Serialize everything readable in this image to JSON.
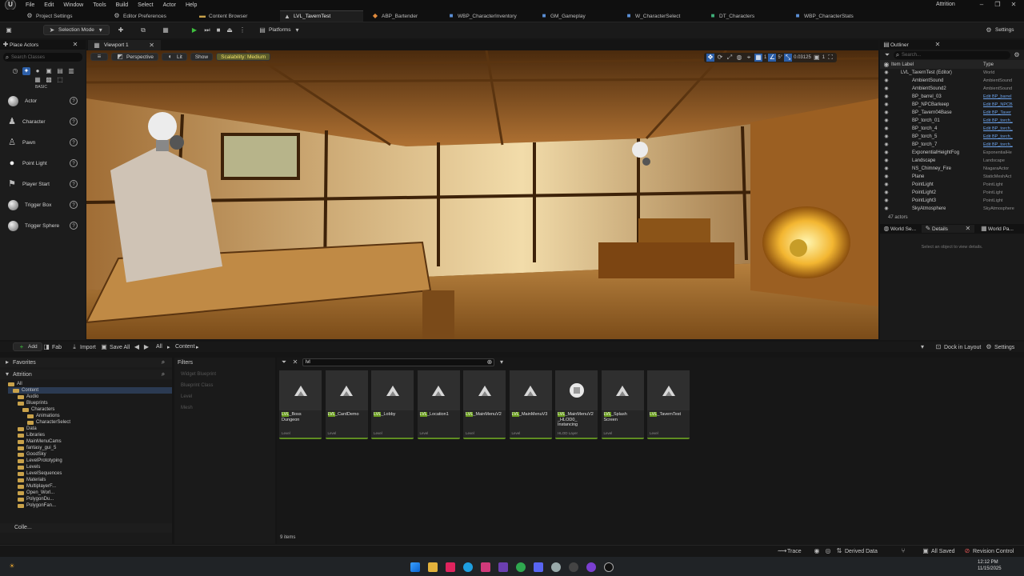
{
  "menu": [
    "File",
    "Edit",
    "Window",
    "Tools",
    "Build",
    "Select",
    "Actor",
    "Help"
  ],
  "project_name": "Attrition",
  "tabs": [
    {
      "label": "Project Settings",
      "icon": "gear-icon"
    },
    {
      "label": "Editor Preferences",
      "icon": "gear-icon"
    },
    {
      "label": "Content Browser",
      "icon": "folder-icon"
    },
    {
      "label": "LVL_TavernTest",
      "icon": "level-icon",
      "active": true
    },
    {
      "label": "ABP_Bartender",
      "icon": "anim-blueprint-icon"
    },
    {
      "label": "WBP_CharacterInventory",
      "icon": "widget-icon"
    },
    {
      "label": "GM_Gameplay",
      "icon": "blueprint-icon"
    },
    {
      "label": "W_CharacterSelect",
      "icon": "widget-icon"
    },
    {
      "label": "DT_Characters",
      "icon": "datatable-icon"
    },
    {
      "label": "WBP_CharacterStats",
      "icon": "widget-icon"
    }
  ],
  "toolbar": {
    "selection_mode": "Selection Mode",
    "platforms": "Platforms",
    "settings": "Settings"
  },
  "place_actors": {
    "title": "Place Actors",
    "search_placeholder": "Search Classes",
    "category": "BASIC",
    "items": [
      "Actor",
      "Character",
      "Pawn",
      "Point Light",
      "Player Start",
      "Trigger Box",
      "Trigger Sphere"
    ]
  },
  "viewport": {
    "tab": "Viewport 1",
    "perspective": "Perspective",
    "lit": "Lit",
    "show": "Show",
    "scalability": "Scalability: Medium",
    "grid_snap": "5°",
    "scale_snap": "0.03125",
    "camera_speed": "1"
  },
  "outliner": {
    "title": "Outliner",
    "search_placeholder": "Search...",
    "col_label": "Item Label",
    "col_type": "Type",
    "rows": [
      {
        "label": "LVL_TavernTest (Editor)",
        "type": "World",
        "link": false,
        "depth": 1
      },
      {
        "label": "AmbientSound",
        "type": "AmbientSound",
        "link": false,
        "depth": 2
      },
      {
        "label": "AmbientSound2",
        "type": "AmbientSound",
        "link": false,
        "depth": 2
      },
      {
        "label": "BP_barrel_03",
        "type": "Edit BP_barrel",
        "link": true,
        "depth": 2
      },
      {
        "label": "BP_NPCBarkeep",
        "type": "Edit BP_NPCB",
        "link": true,
        "depth": 2
      },
      {
        "label": "BP_Tavern04Base",
        "type": "Edit BP_Taver",
        "link": true,
        "depth": 2
      },
      {
        "label": "BP_torch_01",
        "type": "Edit BP_torch_",
        "link": true,
        "depth": 2
      },
      {
        "label": "BP_torch_4",
        "type": "Edit BP_torch_",
        "link": true,
        "depth": 2
      },
      {
        "label": "BP_torch_5",
        "type": "Edit BP_torch_",
        "link": true,
        "depth": 2
      },
      {
        "label": "BP_torch_7",
        "type": "Edit BP_torch_",
        "link": true,
        "depth": 2
      },
      {
        "label": "ExponentialHeightFog",
        "type": "ExponentialHe",
        "link": false,
        "depth": 2
      },
      {
        "label": "Landscape",
        "type": "Landscape",
        "link": false,
        "depth": 2
      },
      {
        "label": "NS_Chimney_Fire",
        "type": "NiagaraActor",
        "link": false,
        "depth": 2
      },
      {
        "label": "Plane",
        "type": "StaticMeshAct",
        "link": false,
        "depth": 2
      },
      {
        "label": "PointLight",
        "type": "PointLight",
        "link": false,
        "depth": 2
      },
      {
        "label": "PointLight2",
        "type": "PointLight",
        "link": false,
        "depth": 2
      },
      {
        "label": "PointLight3",
        "type": "PointLight",
        "link": false,
        "depth": 2
      },
      {
        "label": "SkyAtmosphere",
        "type": "SkyAtmosphere",
        "link": false,
        "depth": 2
      }
    ],
    "count": "47 actors"
  },
  "details": {
    "tabs": [
      "World Se...",
      "Details",
      "World Pa..."
    ],
    "empty": "Select an object to view details."
  },
  "content_browser": {
    "add": "Add",
    "fab": "Fab",
    "import": "Import",
    "save_all": "Save All",
    "crumbs": [
      "All",
      "Content"
    ],
    "dock": "Dock in Layout",
    "settings": "Settings",
    "favorites": "Favorites",
    "root": "Attrition",
    "filters": "Filters",
    "filter_items": [
      "Widget Blueprint",
      "Blueprint Class",
      "Level",
      "Mesh"
    ],
    "search_value": "lvl",
    "tree": [
      {
        "label": "All",
        "d": 0
      },
      {
        "label": "Content",
        "d": 1
      },
      {
        "label": "Audio",
        "d": 2
      },
      {
        "label": "Blueprints",
        "d": 2
      },
      {
        "label": "Characters",
        "d": 3
      },
      {
        "label": "Animations",
        "d": 4
      },
      {
        "label": "CharacterSelect",
        "d": 4
      },
      {
        "label": "Data",
        "d": 2
      },
      {
        "label": "Libraries",
        "d": 2
      },
      {
        "label": "MainMenuCams",
        "d": 2
      },
      {
        "label": "fantasy_gui_5",
        "d": 2
      },
      {
        "label": "GoodSky",
        "d": 2
      },
      {
        "label": "LevelPrototyping",
        "d": 2
      },
      {
        "label": "Levels",
        "d": 2
      },
      {
        "label": "LevelSequences",
        "d": 2
      },
      {
        "label": "Materials",
        "d": 2
      },
      {
        "label": "MultiplayerF...",
        "d": 2
      },
      {
        "label": "Open_Worl...",
        "d": 2
      },
      {
        "label": "PolygonDu...",
        "d": 2
      },
      {
        "label": "PolygonFan...",
        "d": 2
      }
    ],
    "collections": "Colle...",
    "assets": [
      {
        "pre": "LVL",
        "name": "_Boss Dungeon",
        "sub": "Level"
      },
      {
        "pre": "LVL",
        "name": "_CardDemo",
        "sub": "Level"
      },
      {
        "pre": "LVL",
        "name": "_Lobby",
        "sub": "Level"
      },
      {
        "pre": "LVL",
        "name": "_Location1",
        "sub": "Level"
      },
      {
        "pre": "LVL",
        "name": "_MainMenuV2",
        "sub": "Level"
      },
      {
        "pre": "LVL",
        "name": "_MainMenuV3",
        "sub": "Level"
      },
      {
        "pre": "LVL",
        "name": "_MainMenuV2 _HLOD0_ Instancing",
        "sub": "HLOD Layer"
      },
      {
        "pre": "LVL",
        "name": "_Splash Screen",
        "sub": "Level"
      },
      {
        "pre": "LVL",
        "name": "_TavernTest",
        "sub": "Level"
      }
    ],
    "count": "9 items"
  },
  "status": {
    "trace": "Trace",
    "derived": "Derived Data",
    "saved": "All Saved",
    "revision": "Revision Control"
  },
  "clock": {
    "time": "12:12 PM",
    "date": "11/15/2025"
  },
  "colors": {
    "accent": "#6a9d1e",
    "link": "#6aa0e8",
    "folder": "#c9a24a",
    "play": "#3fbf3f"
  }
}
